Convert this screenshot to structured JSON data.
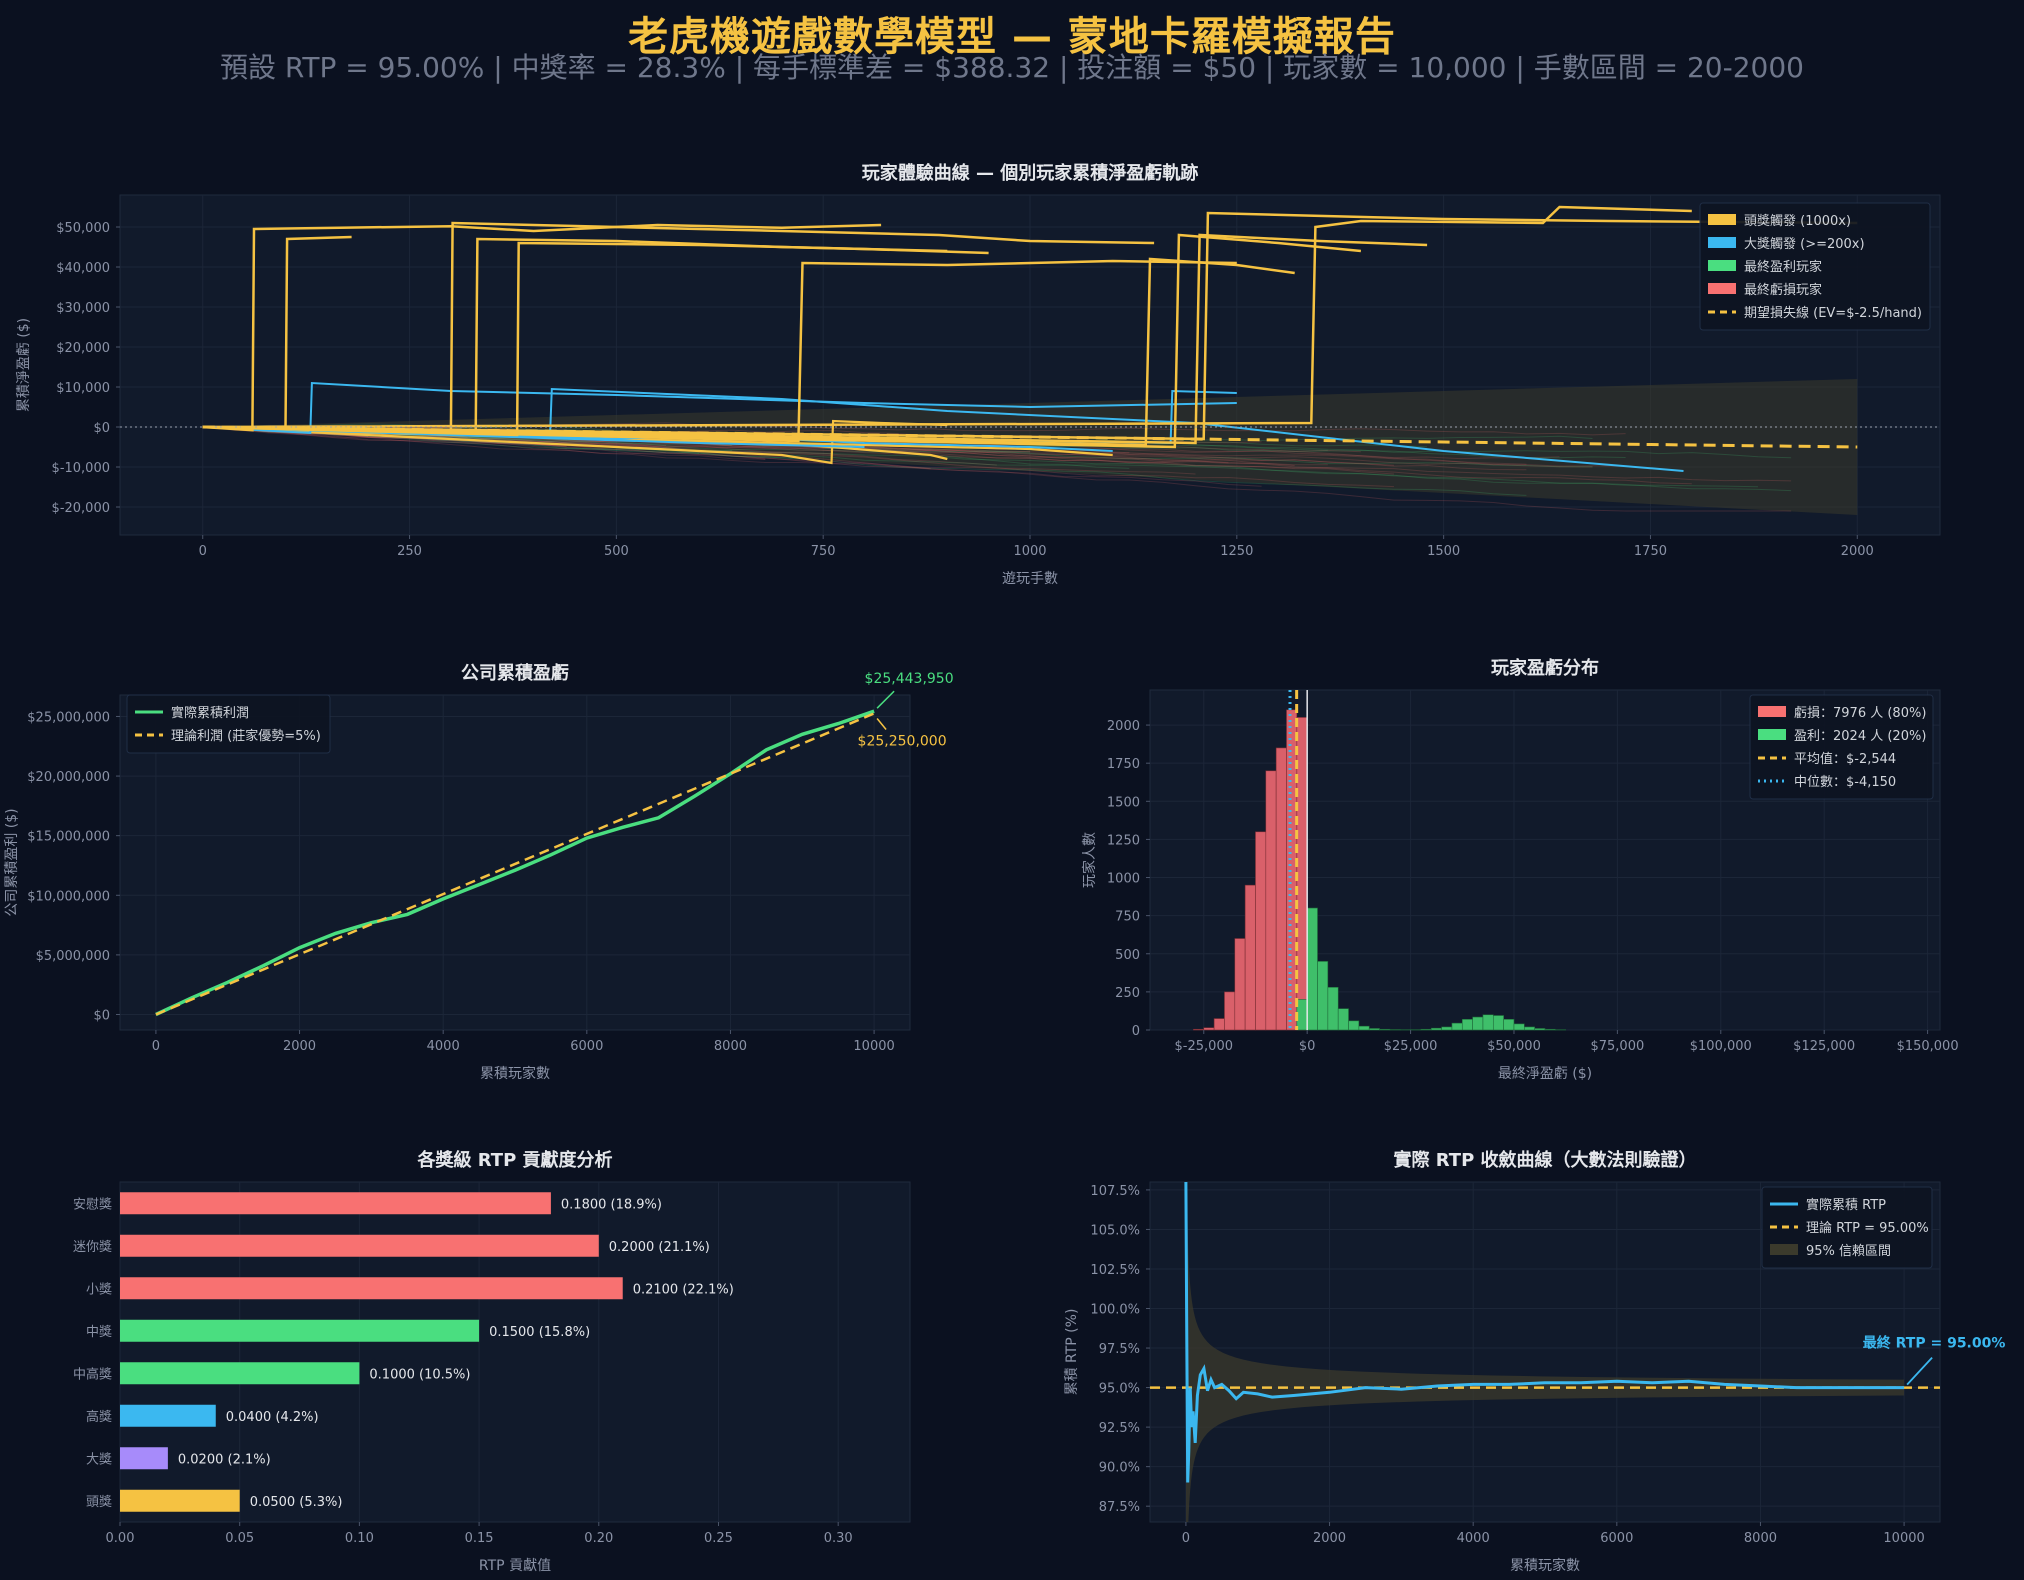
{
  "header": {
    "title": "老虎機遊戲數學模型 — 蒙地卡羅模擬報告",
    "subtitle": "預設 RTP = 95.00% | 中獎率 = 28.3% | 每手標準差 = $388.32 | 投注額 = $50 | 玩家數 = 10,000 | 手數區間 = 20-2000"
  },
  "colors": {
    "background": "#0b1120",
    "panel": "#111a2b",
    "yellow": "#f5c242",
    "blue": "#3bb8f0",
    "green": "#4ade80",
    "red": "#f87171",
    "purple": "#a78bfa",
    "muted_text": "#8b93a7"
  },
  "chart_data": [
    {
      "id": "player_curves",
      "type": "line",
      "title": "玩家體驗曲線 — 個別玩家累積淨盈虧軌跡",
      "xlabel": "遊玩手數",
      "ylabel": "累積淨盈虧 ($)",
      "xlim": [
        -100,
        2100
      ],
      "ylim": [
        -27000,
        58000
      ],
      "xticks": [
        0,
        250,
        500,
        750,
        1000,
        1250,
        1500,
        1750,
        2000
      ],
      "yticks": [
        -20000,
        -10000,
        0,
        10000,
        20000,
        30000,
        40000,
        50000
      ],
      "ytick_labels": [
        "$-20,000",
        "$-10,000",
        "$0",
        "$10,000",
        "$20,000",
        "$30,000",
        "$40,000",
        "$50,000"
      ],
      "grid": true,
      "legend_position": "top-right",
      "legend": [
        {
          "label": "頭獎觸發 (1000x)",
          "color": "#f5c242",
          "kind": "patch"
        },
        {
          "label": "大獎觸發 (>=200x)",
          "color": "#3bb8f0",
          "kind": "patch"
        },
        {
          "label": "最終盈利玩家",
          "color": "#4ade80",
          "kind": "patch"
        },
        {
          "label": "最終虧損玩家",
          "color": "#f87171",
          "kind": "patch"
        },
        {
          "label": "期望損失線 (EV=$-2.5/hand)",
          "color": "#f5c242",
          "kind": "dash"
        }
      ],
      "expected_loss_per_hand": -2.5,
      "ci_band": {
        "x": [
          0,
          2000
        ],
        "upper": [
          0,
          12000
        ],
        "lower": [
          0,
          -22000
        ]
      },
      "jackpot_paths": [
        {
          "x": [
            0,
            60,
            62,
            300,
            400,
            550,
            700,
            820
          ],
          "y": [
            0,
            -800,
            49500,
            50200,
            49000,
            50500,
            49800,
            50500
          ]
        },
        {
          "x": [
            0,
            100,
            102,
            180
          ],
          "y": [
            0,
            -400,
            47000,
            47500
          ]
        },
        {
          "x": [
            0,
            300,
            302,
            500,
            700,
            890,
            1000,
            1150
          ],
          "y": [
            0,
            -1200,
            51000,
            50000,
            49000,
            48000,
            46500,
            46000
          ]
        },
        {
          "x": [
            0,
            330,
            332,
            500,
            700,
            900
          ],
          "y": [
            0,
            -1500,
            47000,
            46500,
            45000,
            44000
          ]
        },
        {
          "x": [
            0,
            380,
            382,
            600,
            800,
            950
          ],
          "y": [
            0,
            -2000,
            46000,
            45500,
            44500,
            43500
          ]
        },
        {
          "x": [
            0,
            720,
            725,
            900,
            1100,
            1250
          ],
          "y": [
            0,
            -3500,
            41000,
            40500,
            41500,
            41000
          ]
        },
        {
          "x": [
            0,
            1140,
            1145,
            1250,
            1320
          ],
          "y": [
            0,
            -4500,
            42000,
            40500,
            38500
          ]
        },
        {
          "x": [
            0,
            1175,
            1180,
            1300,
            1400
          ],
          "y": [
            0,
            -5000,
            48000,
            46000,
            44000
          ]
        },
        {
          "x": [
            0,
            1200,
            1205,
            1350,
            1480
          ],
          "y": [
            0,
            -4000,
            48000,
            46500,
            45500
          ]
        },
        {
          "x": [
            0,
            1210,
            1215,
            1500,
            1700,
            2000
          ],
          "y": [
            0,
            -3000,
            53500,
            52000,
            51500,
            51000
          ]
        },
        {
          "x": [
            0,
            1340,
            1345,
            1400,
            1620,
            1640,
            1800
          ],
          "y": [
            0,
            1000,
            50000,
            51500,
            51000,
            55000,
            54000
          ]
        }
      ],
      "bigwin_paths": [
        {
          "x": [
            0,
            130,
            132,
            300,
            500,
            800,
            1000,
            1250
          ],
          "y": [
            0,
            -1500,
            11000,
            9000,
            8000,
            6000,
            5000,
            6000
          ]
        },
        {
          "x": [
            0,
            420,
            422,
            700,
            900,
            1200,
            1500,
            1790
          ],
          "y": [
            0,
            -1000,
            9500,
            7000,
            4000,
            1000,
            -6000,
            -11000
          ]
        },
        {
          "x": [
            0,
            500,
            600,
            800,
            1000,
            1100
          ],
          "y": [
            0,
            -3000,
            -2000,
            -4000,
            -5000,
            -6000
          ]
        },
        {
          "x": [
            0,
            600,
            700,
            800
          ],
          "y": [
            0,
            -4000,
            -4500,
            -5000
          ]
        },
        {
          "x": [
            0,
            1170,
            1172,
            1250
          ],
          "y": [
            0,
            -4000,
            9000,
            8500
          ]
        }
      ],
      "yellow_mid_paths": [
        {
          "x": [
            0,
            300,
            500,
            700,
            760,
            762,
            820,
            900
          ],
          "y": [
            0,
            -3000,
            -5000,
            -7000,
            -9000,
            1500,
            1000,
            500
          ]
        },
        {
          "x": [
            0,
            200,
            400,
            600,
            800,
            1000,
            1100
          ],
          "y": [
            0,
            -1500,
            -2500,
            -3500,
            -4500,
            -5500,
            -7000
          ]
        },
        {
          "x": [
            0,
            500,
            700,
            880,
            900
          ],
          "y": [
            0,
            -3000,
            -4000,
            -7000,
            -8000
          ]
        }
      ]
    },
    {
      "id": "company_profit",
      "type": "line",
      "title": "公司累積盈虧",
      "xlabel": "累積玩家數",
      "ylabel": "公司累積盈利 ($)",
      "xlim": [
        -500,
        10500
      ],
      "ylim": [
        -1300000,
        26800000
      ],
      "xticks": [
        0,
        2000,
        4000,
        6000,
        8000,
        10000
      ],
      "yticks": [
        0,
        5000000,
        10000000,
        15000000,
        20000000,
        25000000
      ],
      "ytick_labels": [
        "$0",
        "$5,000,000",
        "$10,000,000",
        "$15,000,000",
        "$20,000,000",
        "$25,000,000"
      ],
      "grid": true,
      "legend_position": "top-left",
      "legend": [
        {
          "label": "實際累積利潤",
          "color": "#4ade80",
          "kind": "line"
        },
        {
          "label": "理論利潤 (莊家優勢=5%)",
          "color": "#f5c242",
          "kind": "dash"
        }
      ],
      "series": [
        {
          "name": "實際累積利潤",
          "x": [
            0,
            500,
            1000,
            1500,
            2000,
            2500,
            3000,
            3500,
            4000,
            4500,
            5000,
            5500,
            6000,
            6500,
            7000,
            7500,
            8000,
            8500,
            9000,
            9500,
            10000
          ],
          "values": [
            0,
            1400000,
            2700000,
            4100000,
            5600000,
            6800000,
            7700000,
            8400000,
            9700000,
            10900000,
            12100000,
            13400000,
            14800000,
            15700000,
            16500000,
            18300000,
            20200000,
            22200000,
            23500000,
            24400000,
            25443950
          ]
        },
        {
          "name": "理論利潤 (莊家優勢=5%)",
          "x": [
            0,
            10000
          ],
          "values": [
            0,
            25250000
          ]
        }
      ],
      "annotations": [
        {
          "text": "$25,443,950",
          "color": "#4ade80"
        },
        {
          "text": "$25,250,000",
          "color": "#f5c242"
        }
      ]
    },
    {
      "id": "player_distribution",
      "type": "bar",
      "title": "玩家盈虧分布",
      "xlabel": "最終淨盈虧 ($)",
      "ylabel": "玩家人數",
      "xlim": [
        -38000,
        153000
      ],
      "ylim": [
        0,
        2230
      ],
      "xticks": [
        -25000,
        0,
        25000,
        50000,
        75000,
        100000,
        125000,
        150000
      ],
      "xtick_labels": [
        "$-25,000",
        "$0",
        "$25,000",
        "$50,000",
        "$75,000",
        "$100,000",
        "$125,000",
        "$150,000"
      ],
      "yticks": [
        0,
        250,
        500,
        750,
        1000,
        1250,
        1500,
        1750,
        2000
      ],
      "grid": true,
      "legend_position": "top-right",
      "legend": [
        {
          "label": "虧損：7976 人 (80%)",
          "color": "#f87171",
          "kind": "patch"
        },
        {
          "label": "盈利：2024 人 (20%)",
          "color": "#4ade80",
          "kind": "patch"
        },
        {
          "label": "平均值：$-2,544",
          "color": "#f5c242",
          "kind": "dash"
        },
        {
          "label": "中位數：$-4,150",
          "color": "#3bb8f0",
          "kind": "dot"
        }
      ],
      "bin_width": 2500,
      "loss_bins": {
        "x0": [
          -27500,
          -25000,
          -22500,
          -20000,
          -17500,
          -15000,
          -12500,
          -10000,
          -7500,
          -5000,
          -2500
        ],
        "values": [
          5,
          15,
          75,
          250,
          600,
          950,
          1300,
          1700,
          1850,
          2100,
          2050
        ]
      },
      "win_bins": {
        "x0": [
          -2500,
          0,
          2500,
          5000,
          7500,
          10000,
          12500,
          15000,
          17500,
          20000,
          22500,
          25000,
          27500,
          30000,
          32500,
          35000,
          37500,
          40000,
          42500,
          45000,
          47500,
          50000,
          52500,
          55000,
          57500,
          60000
        ],
        "values": [
          200,
          800,
          450,
          280,
          140,
          60,
          25,
          10,
          5,
          3,
          2,
          2,
          5,
          12,
          20,
          45,
          70,
          85,
          100,
          95,
          70,
          40,
          20,
          10,
          5,
          2
        ]
      },
      "mean": -2544,
      "median": -4150
    },
    {
      "id": "rtp_contribution",
      "type": "bar",
      "orientation": "horizontal",
      "title": "各獎級 RTP 貢獻度分析",
      "xlabel": "RTP 貢獻值",
      "ylabel": "",
      "xlim": [
        0,
        0.33
      ],
      "xticks": [
        0.0,
        0.05,
        0.1,
        0.15,
        0.2,
        0.25,
        0.3
      ],
      "xtick_labels": [
        "0.00",
        "0.05",
        "0.10",
        "0.15",
        "0.20",
        "0.25",
        "0.30"
      ],
      "grid": true,
      "categories": [
        "安慰獎",
        "迷你獎",
        "小獎",
        "中獎",
        "中高獎",
        "高獎",
        "大獎",
        "頭獎"
      ],
      "values": [
        0.18,
        0.2,
        0.21,
        0.15,
        0.1,
        0.04,
        0.02,
        0.05
      ],
      "value_labels": [
        "0.1800  (18.9%)",
        "0.2000  (21.1%)",
        "0.2100  (22.1%)",
        "0.1500  (15.8%)",
        "0.1000  (10.5%)",
        "0.0400  (4.2%)",
        "0.0200  (2.1%)",
        "0.0500  (5.3%)"
      ],
      "bar_colors": [
        "#f87171",
        "#f87171",
        "#f87171",
        "#4ade80",
        "#4ade80",
        "#3bb8f0",
        "#a78bfa",
        "#f5c242"
      ]
    },
    {
      "id": "rtp_convergence",
      "type": "line",
      "title": "實際 RTP 收斂曲線（大數法則驗證）",
      "xlabel": "累積玩家數",
      "ylabel": "累積 RTP (%)",
      "xlim": [
        -500,
        10500
      ],
      "ylim": [
        86.5,
        108.0
      ],
      "xticks": [
        0,
        2000,
        4000,
        6000,
        8000,
        10000
      ],
      "yticks": [
        87.5,
        90.0,
        92.5,
        95.0,
        97.5,
        100.0,
        102.5,
        105.0,
        107.5
      ],
      "ytick_labels": [
        "87.5%",
        "90.0%",
        "92.5%",
        "95.0%",
        "97.5%",
        "100.0%",
        "102.5%",
        "105.0%",
        "107.5%"
      ],
      "grid": true,
      "legend_position": "top-right",
      "legend": [
        {
          "label": "實際累積 RTP",
          "color": "#3bb8f0",
          "kind": "line"
        },
        {
          "label": "理論 RTP = 95.00%",
          "color": "#f5c242",
          "kind": "dash"
        },
        {
          "label": "95% 信賴區間",
          "color": "#3b3a2c",
          "kind": "patch"
        }
      ],
      "series": [
        {
          "name": "實際累積 RTP",
          "x": [
            0,
            10,
            25,
            40,
            60,
            80,
            100,
            130,
            160,
            200,
            250,
            300,
            350,
            400,
            500,
            600,
            700,
            800,
            1000,
            1200,
            1500,
            2000,
            2500,
            3000,
            3500,
            4000,
            4500,
            5000,
            5500,
            6000,
            6500,
            7000,
            7500,
            8000,
            8500,
            9000,
            9500,
            10000
          ],
          "values": [
            108.0,
            100.0,
            89.0,
            91.0,
            95.0,
            92.5,
            93.5,
            91.5,
            94.5,
            95.8,
            96.2,
            94.8,
            95.5,
            95.0,
            95.2,
            94.8,
            94.3,
            94.7,
            94.6,
            94.4,
            94.5,
            94.7,
            95.0,
            94.9,
            95.1,
            95.2,
            95.2,
            95.3,
            95.3,
            95.4,
            95.3,
            95.4,
            95.2,
            95.1,
            95.0,
            95.0,
            95.0,
            95.0
          ]
        }
      ],
      "theory": 95.0,
      "ci_half_width_at_1": 50,
      "annotation": {
        "text": "最終 RTP = 95.00%",
        "color": "#3bb8f0"
      }
    }
  ]
}
